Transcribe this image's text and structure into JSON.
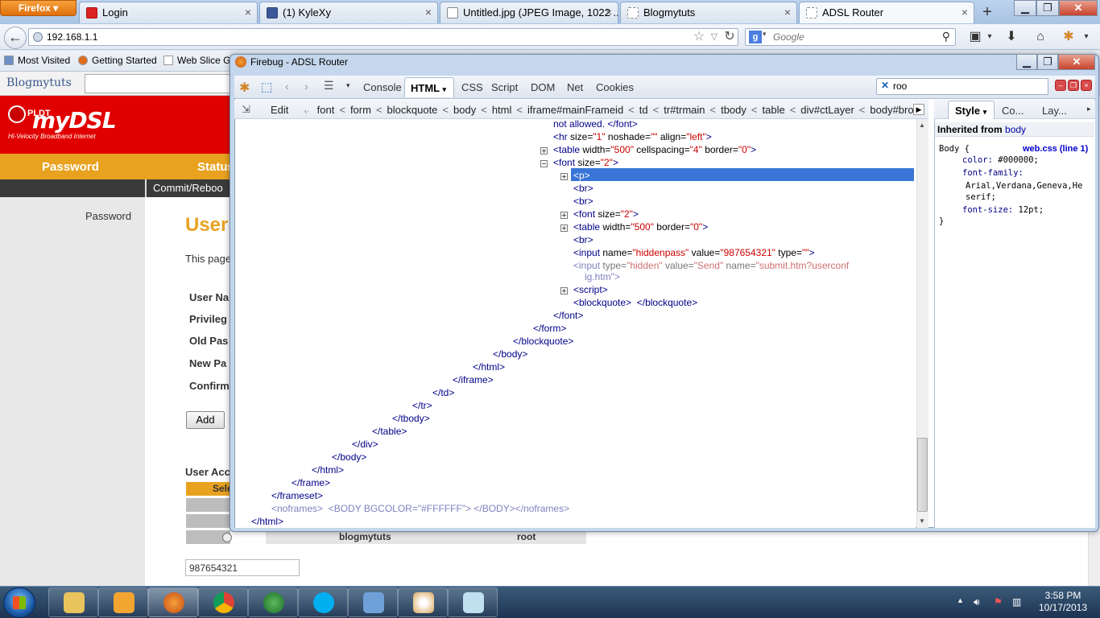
{
  "browser": {
    "menu_label": "Firefox",
    "tabs": [
      {
        "label": "Login"
      },
      {
        "label": "(1) KyleXy"
      },
      {
        "label": "Untitled.jpg (JPEG Image, 1022 ..."
      },
      {
        "label": "Blogmytuts"
      },
      {
        "label": "ADSL Router"
      }
    ],
    "new_tab": "+",
    "url": "192.168.1.1",
    "search_placeholder": "Google",
    "bookmarks": [
      "Most Visited",
      "Getting Started",
      "Web Slice G"
    ]
  },
  "blogbar": {
    "logo": "Blogmytuts"
  },
  "router_page": {
    "brand_pldt": "PLDT",
    "brand_name": "myDSL",
    "brand_tagline": "Hi-Velocity Broadband Internet",
    "nav": [
      "Password",
      "Status"
    ],
    "subnav": "Commit/Reboo",
    "left_menu": "Password",
    "title": "User",
    "intro": "This page",
    "fields": [
      "User Na",
      "Privileg",
      "Old Pas",
      "New Pa",
      "Confirm"
    ],
    "add_button": "Add",
    "user_accounts_label": "User Acc",
    "select_header": "Sele",
    "row_user": "blogmytuts",
    "row_priv": "root",
    "hidden_value": "987654321"
  },
  "firebug": {
    "title": "Firebug - ADSL Router",
    "tabs": [
      "Console",
      "HTML",
      "CSS",
      "Script",
      "DOM",
      "Net",
      "Cookies"
    ],
    "search_value": "roo",
    "edit_label": "Edit",
    "breadcrumbs": [
      "font",
      "form",
      "blockquote",
      "body",
      "html",
      "iframe#mainFrameid",
      "td",
      "tr#trmain",
      "tbody",
      "table",
      "div#ctLayer",
      "body#brov"
    ],
    "side_tabs": [
      "Style",
      "Co...",
      "Lay..."
    ],
    "inherited_label": "Inherited from",
    "inherited_tag": "body",
    "css_selector": "Body {",
    "css_file": "web.css (line 1)",
    "css_lines": [
      {
        "prop": "color:",
        "val": " #000000;"
      },
      {
        "prop": "font-family:",
        "val": ""
      },
      {
        "prop": "",
        "val": "Arial,Verdana,Geneva,He"
      },
      {
        "prop": "",
        "val": "serif;"
      },
      {
        "prop": "font-size:",
        "val": " 12pt;"
      }
    ],
    "css_close": "}",
    "html_lines": [
      {
        "text": "not allowed. </font>"
      },
      {
        "pre": "<hr ",
        "a1": "size=",
        "v1": "\"1\"",
        "a2": " noshade=",
        "v2": "\"\"",
        "a3": " align=",
        "v3": "\"left\"",
        "post": ">"
      },
      {
        "pre": "<table ",
        "a1": "width=",
        "v1": "\"500\"",
        "a2": " cellspacing=",
        "v2": "\"4\"",
        "a3": " border=",
        "v3": "\"0\"",
        "post": ">"
      },
      {
        "pre": "<font ",
        "a1": "size=",
        "v1": "\"2\"",
        "post": ">"
      },
      {
        "text": "<p>"
      },
      {
        "text": "<br>"
      },
      {
        "text": "<br>"
      },
      {
        "pre": "<font ",
        "a1": "size=",
        "v1": "\"2\"",
        "post": ">"
      },
      {
        "pre": "<table ",
        "a1": "width=",
        "v1": "\"500\"",
        "a2": " border=",
        "v2": "\"0\"",
        "post": ">"
      },
      {
        "text": "<br>"
      },
      {
        "pre": "<input ",
        "a1": "name=",
        "v1": "\"hiddenpass\"",
        "a2": " value=",
        "v2": "\"987654321\"",
        "a3": " type=",
        "v3": "\"\"",
        "post": ">"
      },
      {
        "pre": "<input ",
        "a1": "type=",
        "v1": "\"hidden\"",
        "a2": " value=",
        "v2": "\"Send\"",
        "a3": " name=",
        "v3": "\"submit.htm?userconf",
        "post": ""
      },
      {
        "text": "ig.htm\">"
      },
      {
        "text": "<script>"
      },
      {
        "text": "<blockquote>  </blockquote>"
      },
      {
        "text": "</font>"
      },
      {
        "text": "</form>"
      },
      {
        "text": "</blockquote>"
      },
      {
        "text": "</body>"
      },
      {
        "text": "</html>"
      },
      {
        "text": "</iframe>"
      },
      {
        "text": "</td>"
      },
      {
        "text": "</tr>"
      },
      {
        "text": "</tbody>"
      },
      {
        "text": "</table>"
      },
      {
        "text": "</div>"
      },
      {
        "text": "</body>"
      },
      {
        "text": "</html>"
      },
      {
        "text": "</frame>"
      },
      {
        "text": "</frameset>"
      },
      {
        "text": "<noframes>  <BODY BGCOLOR=\"#FFFFFF\"> </BODY></noframes>"
      },
      {
        "text": "</html>"
      }
    ]
  },
  "taskbar": {
    "time": "3:58 PM",
    "date": "10/17/2013"
  },
  "colors": {
    "router_red": "#e10000",
    "router_orange": "#e8a220",
    "firebug_selection": "#3875d7"
  }
}
